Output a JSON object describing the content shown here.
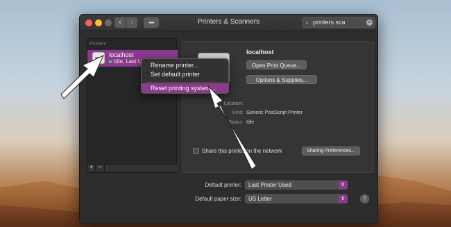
{
  "window": {
    "title": "Printers & Scanners"
  },
  "toolbar": {
    "search_value": "printers sca"
  },
  "printers_list": {
    "header": "Printers",
    "items": [
      {
        "name": "localhost",
        "status": "Idle, Last Us"
      }
    ],
    "add_label": "+",
    "remove_label": "−"
  },
  "detail": {
    "name": "localhost",
    "open_queue_label": "Open Print Queue...",
    "options_label": "Options & Supplies...",
    "location_label": "Location:",
    "kind_label": "Kind:",
    "kind_value": "Generic PostScript Printer",
    "status_label": "Status:",
    "status_value": "Idle",
    "share_label": "Share this printer on the network",
    "sharing_prefs_label": "Sharing Preferences..."
  },
  "context_menu": {
    "items": [
      "Rename printer...",
      "Set default printer",
      "Reset printing system..."
    ],
    "selected": "Reset printing system..."
  },
  "defaults": {
    "default_printer_label": "Default printer:",
    "default_printer_value": "Last Printer Used",
    "default_paper_label": "Default paper size:",
    "default_paper_value": "US Letter"
  },
  "colors": {
    "accent": "#8a3b8b",
    "window_bg": "#2d2d2d"
  }
}
